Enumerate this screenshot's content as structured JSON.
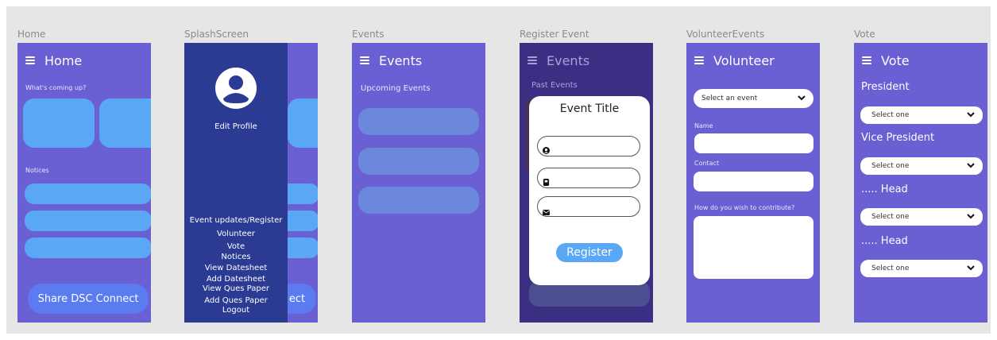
{
  "frames": [
    {
      "key": "home",
      "label": "Home"
    },
    {
      "key": "splash",
      "label": "SplashScreen"
    },
    {
      "key": "events",
      "label": "Events"
    },
    {
      "key": "register",
      "label": "Register Event"
    },
    {
      "key": "volunteer",
      "label": "VolunteerEvents"
    },
    {
      "key": "vote",
      "label": "Vote"
    }
  ],
  "home": {
    "title": "Home",
    "coming_up": "What's coming up?",
    "notices": "Notices",
    "share_button": "Share DSC Connect"
  },
  "splash": {
    "edit_profile": "Edit Profile",
    "menu": [
      "Event updates/Register",
      "Volunteer",
      "Vote",
      "Notices",
      "View Datesheet",
      "Add Datesheet",
      "View Ques Paper",
      "Add Ques Paper",
      "Logout"
    ],
    "peek_button_text": "ect"
  },
  "events": {
    "title": "Events",
    "upcoming": "Upcoming Events"
  },
  "register": {
    "title": "Events",
    "past_events": "Past Events",
    "modal_title": "Event Title",
    "register_button": "Register"
  },
  "volunteer": {
    "title": "Volunteer",
    "select_event": "Select an event",
    "name_label": "Name",
    "contact_label": "Contact",
    "contribute_label": "How do you wish to contribute?"
  },
  "vote": {
    "title": "Vote",
    "sections": [
      {
        "heading": "President",
        "select": "Select one"
      },
      {
        "heading": "Vice President",
        "select": "Select one"
      },
      {
        "heading": "..... Head",
        "select": "Select one"
      },
      {
        "heading": "..... Head",
        "select": "Select one"
      }
    ]
  },
  "colors": {
    "purple": "#6a5fd3",
    "drawer": "#2b3a93",
    "accent_blue": "#5aa8f5",
    "dim_blue": "#6b88dc"
  }
}
